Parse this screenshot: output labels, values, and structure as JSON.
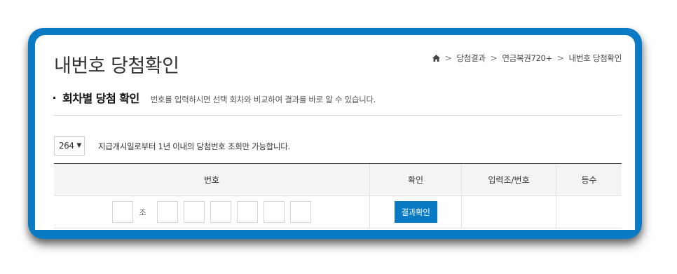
{
  "page": {
    "title": "내번호 당첨확인"
  },
  "breadcrumb": {
    "items": [
      "당첨결과",
      "연금복권720+",
      "내번호 당첨확인"
    ]
  },
  "section": {
    "title": "회차별 당첨 확인",
    "description": "번호를 입력하시면 선택 회차와 비교하여 결과를 바로 알 수 있습니다."
  },
  "round_select": {
    "value": "264"
  },
  "notice": "지급개시일로부터 1년 이내의 당첨번호 조회만 가능합니다.",
  "table": {
    "headers": [
      "번호",
      "확인",
      "입력조/번호",
      "등수"
    ],
    "group_label": "조",
    "confirm_label": "결과확인"
  },
  "colors": {
    "accent": "#0a7ac4"
  }
}
